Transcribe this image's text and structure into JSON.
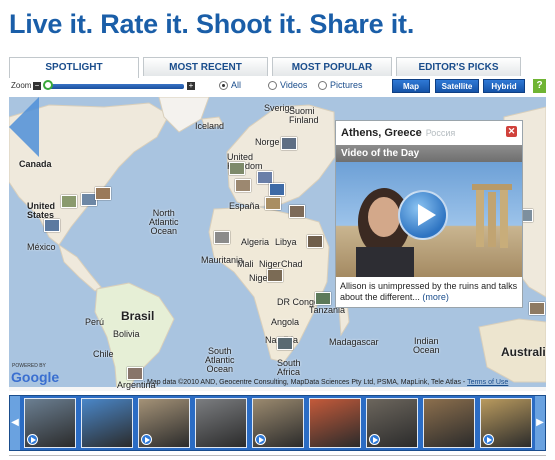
{
  "headline": "Live it. Rate it. Shoot it. Share it.",
  "tabs": [
    {
      "label": "SPOTLIGHT",
      "active": true
    },
    {
      "label": "MOST RECENT",
      "active": false
    },
    {
      "label": "MOST POPULAR",
      "active": false
    },
    {
      "label": "EDITOR'S PICKS",
      "active": false
    }
  ],
  "toolbar": {
    "zoom_label": "Zoom",
    "zoom_minus": "−",
    "zoom_plus": "+",
    "filters": [
      {
        "label": "All",
        "selected": true
      },
      {
        "label": "Videos",
        "selected": false
      },
      {
        "label": "Pictures",
        "selected": false
      }
    ],
    "map_types": [
      "Map",
      "Satellite",
      "Hybrid"
    ],
    "help": "?"
  },
  "map": {
    "labels": {
      "canada": "Canada",
      "united_states": "United\nStates",
      "mexico": "México",
      "north_atlantic": "North\nAtlantic\nOcean",
      "south_atlantic": "South\nAtlantic\nOcean",
      "brasil": "Brasil",
      "peru": "Perú",
      "bolivia": "Bolivia",
      "chile": "Chile",
      "argentina": "Argentina",
      "iceland": "Iceland",
      "sverige": "Sverige",
      "suomi": "Suomi\nFinland",
      "norge": "Norge",
      "united_kingdom": "United\nKingdom",
      "espana": "España",
      "algeria": "Algeria",
      "libya": "Libya",
      "mauritania": "Mauritania",
      "mali": "Mali",
      "niger": "Niger",
      "chad": "Chad",
      "nigeria": "Nigeria",
      "dr_congo": "DR Congo",
      "angola": "Angola",
      "namibia": "Namibia",
      "south_africa": "South\nAfrica",
      "madagascar": "Madagascar",
      "indian_ocean": "Indian\nOcean",
      "australia": "Australia",
      "tanzania": "Tanzania"
    },
    "powered_by": "POWERED BY",
    "google": "Google",
    "attribution": "Map data ©2010 AND, Geocentre Consulting, MapData Sciences Pty Ltd, PSMA, MapLink, Tele Atlas -",
    "terms": "Terms of Use"
  },
  "popup": {
    "location": "Athens, Greece",
    "sublocation": "Россия",
    "close": "✕",
    "section": "Video of the Day",
    "caption": "Allison is unimpressed by the ruins and talks about the different...",
    "more": "(more)"
  },
  "strip": {
    "prev": "◀",
    "next": "▶",
    "thumb_colors": [
      "#6b7f92",
      "#4a87c9",
      "#a49277",
      "#7b7d80",
      "#9b8a6f",
      "#c45a3a",
      "#6c665d",
      "#8c6f4d",
      "#b99a5e"
    ]
  }
}
